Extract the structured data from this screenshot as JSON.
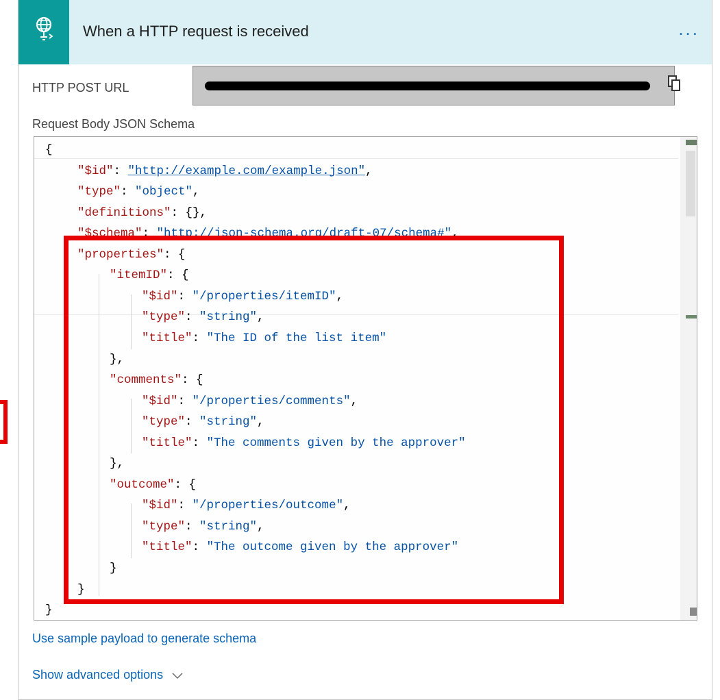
{
  "header": {
    "title": "When a HTTP request is received",
    "icon": "globe-request-icon",
    "menu_label": "...",
    "accent_color": "#0b9b9b",
    "header_bg": "#daf0f4"
  },
  "fields": {
    "url_label": "HTTP POST URL",
    "url_value_redacted": true,
    "copy_icon": "copy-icon",
    "schema_label": "Request Body JSON Schema"
  },
  "schema_lines": [
    [
      {
        "c": "pun",
        "t": "{"
      }
    ],
    [
      {
        "c": "key",
        "t": "\"$id\""
      },
      {
        "c": "pun",
        "t": ": "
      },
      {
        "c": "str link",
        "t": "\"http://example.com/example.json\""
      },
      {
        "c": "pun",
        "t": ","
      }
    ],
    [
      {
        "c": "key",
        "t": "\"type\""
      },
      {
        "c": "pun",
        "t": ": "
      },
      {
        "c": "str",
        "t": "\"object\""
      },
      {
        "c": "pun",
        "t": ","
      }
    ],
    [
      {
        "c": "key",
        "t": "\"definitions\""
      },
      {
        "c": "pun",
        "t": ": {},"
      }
    ],
    [
      {
        "c": "key",
        "t": "\"$schema\""
      },
      {
        "c": "pun",
        "t": ": "
      },
      {
        "c": "str link",
        "t": "\"http://json-schema.org/draft-07/schema#\""
      },
      {
        "c": "pun",
        "t": ","
      }
    ],
    [
      {
        "c": "key",
        "t": "\"properties\""
      },
      {
        "c": "pun",
        "t": ": {"
      }
    ],
    [
      {
        "c": "key",
        "t": "\"itemID\""
      },
      {
        "c": "pun",
        "t": ": {"
      }
    ],
    [
      {
        "c": "key",
        "t": "\"$id\""
      },
      {
        "c": "pun",
        "t": ": "
      },
      {
        "c": "str",
        "t": "\"/properties/itemID\""
      },
      {
        "c": "pun",
        "t": ","
      }
    ],
    [
      {
        "c": "key",
        "t": "\"type\""
      },
      {
        "c": "pun",
        "t": ": "
      },
      {
        "c": "str",
        "t": "\"string\""
      },
      {
        "c": "pun",
        "t": ","
      }
    ],
    [
      {
        "c": "key",
        "t": "\"title\""
      },
      {
        "c": "pun",
        "t": ": "
      },
      {
        "c": "str",
        "t": "\"The ID of the list item\""
      }
    ],
    [
      {
        "c": "pun",
        "t": "},"
      }
    ],
    [
      {
        "c": "key",
        "t": "\"comments\""
      },
      {
        "c": "pun",
        "t": ": {"
      }
    ],
    [
      {
        "c": "key",
        "t": "\"$id\""
      },
      {
        "c": "pun",
        "t": ": "
      },
      {
        "c": "str",
        "t": "\"/properties/comments\""
      },
      {
        "c": "pun",
        "t": ","
      }
    ],
    [
      {
        "c": "key",
        "t": "\"type\""
      },
      {
        "c": "pun",
        "t": ": "
      },
      {
        "c": "str",
        "t": "\"string\""
      },
      {
        "c": "pun",
        "t": ","
      }
    ],
    [
      {
        "c": "key",
        "t": "\"title\""
      },
      {
        "c": "pun",
        "t": ": "
      },
      {
        "c": "str",
        "t": "\"The comments given by the approver\""
      }
    ],
    [
      {
        "c": "pun",
        "t": "},"
      }
    ],
    [
      {
        "c": "key",
        "t": "\"outcome\""
      },
      {
        "c": "pun",
        "t": ": {"
      }
    ],
    [
      {
        "c": "key",
        "t": "\"$id\""
      },
      {
        "c": "pun",
        "t": ": "
      },
      {
        "c": "str",
        "t": "\"/properties/outcome\""
      },
      {
        "c": "pun",
        "t": ","
      }
    ],
    [
      {
        "c": "key",
        "t": "\"type\""
      },
      {
        "c": "pun",
        "t": ": "
      },
      {
        "c": "str",
        "t": "\"string\""
      },
      {
        "c": "pun",
        "t": ","
      }
    ],
    [
      {
        "c": "key",
        "t": "\"title\""
      },
      {
        "c": "pun",
        "t": ": "
      },
      {
        "c": "str",
        "t": "\"The outcome given by the approver\""
      }
    ],
    [
      {
        "c": "pun",
        "t": "}"
      }
    ],
    [
      {
        "c": "pun",
        "t": "}"
      }
    ],
    [
      {
        "c": "pun",
        "t": "}"
      }
    ]
  ],
  "links": {
    "sample_payload": "Use sample payload to generate schema",
    "advanced": "Show advanced options",
    "advanced_icon": "chevron-down-icon"
  },
  "annotation": {
    "highlight_color": "#e60000"
  }
}
